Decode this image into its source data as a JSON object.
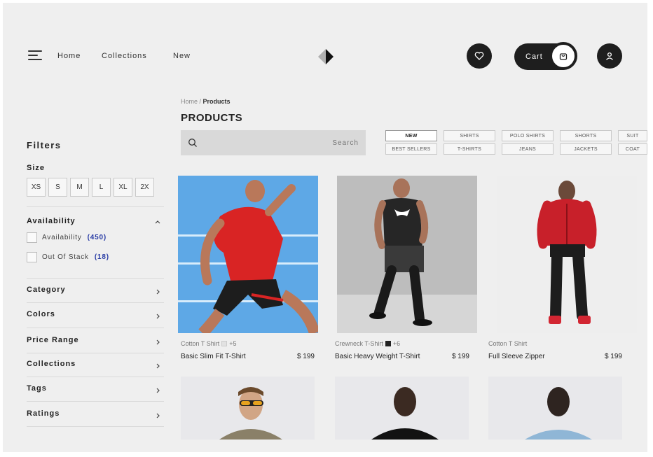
{
  "header": {
    "nav": [
      "Home",
      "Collections",
      "New"
    ],
    "cart_label": "Cart"
  },
  "sidebar": {
    "filters_title": "Filters",
    "size_title": "Size",
    "sizes": [
      "XS",
      "S",
      "M",
      "L",
      "XL",
      "2X"
    ],
    "availability": {
      "title": "Availability",
      "options": [
        {
          "label": "Availability",
          "count": "(450)"
        },
        {
          "label": "Out Of Stack",
          "count": "(18)"
        }
      ]
    },
    "sections": [
      "Category",
      "Colors",
      "Price Range",
      "Collections",
      "Tags",
      "Ratings"
    ]
  },
  "main": {
    "breadcrumb": {
      "home": "Home",
      "separator": " / ",
      "current": "Products"
    },
    "title": "PRODUCTS",
    "search_placeholder": "Search",
    "categories_row1": [
      "NEW",
      "SHIRTS",
      "POLO SHIRTS",
      "SHORTS",
      "SUIT"
    ],
    "categories_row2": [
      "BEST SELLERS",
      "T-SHIRTS",
      "JEANS",
      "JACKETS",
      "COAT"
    ],
    "products": [
      {
        "sub": "Cotton T Shirt",
        "swatch_count": "+5",
        "swatch_color": "#e2e2e2",
        "name": "Basic Slim Fit T-Shirt",
        "price": "$ 199"
      },
      {
        "sub": "Crewneck T-Shirt",
        "swatch_count": "+6",
        "swatch_color": "#222222",
        "name": "Basic Heavy Weight T-Shirt",
        "price": "$ 199"
      },
      {
        "sub": "Cotton T Shirt",
        "swatch_count": "",
        "swatch_color": "",
        "name": "Full Sleeve Zipper",
        "price": "$ 199"
      }
    ]
  },
  "colors": {
    "dark": "#1e1e1e",
    "accent_count": "#2b3ea6",
    "background": "#efefef"
  }
}
